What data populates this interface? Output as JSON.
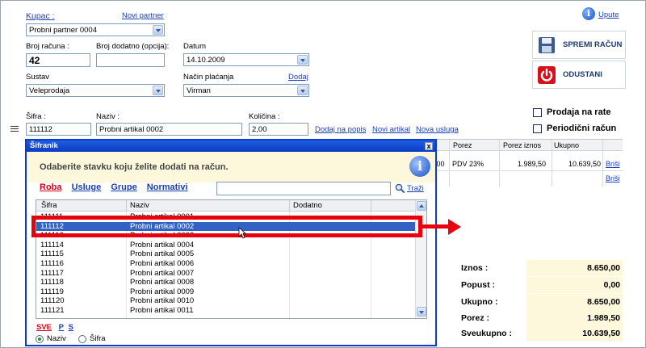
{
  "header": {
    "kupac_label": "Kupac :",
    "novi_partner": "Novi partner",
    "kupac_value": "Probni partner 0004",
    "upute": "Upute"
  },
  "form": {
    "broj_racuna_label": "Broj računa :",
    "broj_racuna_value": "42",
    "broj_dodatno_label": "Broj dodatno (opcija):",
    "broj_dodatno_value": "",
    "datum_label": "Datum",
    "datum_value": "14.10.2009",
    "sustav_label": "Sustav",
    "sustav_value": "Veleprodaja",
    "nacin_placanja_label": "Način plaćanja",
    "dodaj": "Dodaj",
    "nacin_placanja_value": "Virman"
  },
  "item_entry": {
    "sifra_label": "Šifra :",
    "sifra_value": "111112",
    "naziv_label": "Naziv :",
    "naziv_value": "Probni artikal 0002",
    "kolicina_label": "Količina :",
    "kolicina_value": "2,00",
    "dodaj_na_popis": "Dodaj na popis",
    "novi_artikal": "Novi artikal",
    "nova_usluga": "Nova usluga"
  },
  "side": {
    "spremi_label": "SPREMI RAČUN",
    "odustani_label": "ODUSTANI",
    "prodaja_na_rate": "Prodaja na rate",
    "periodicni_racun": "Periodični račun"
  },
  "bg_table": {
    "headers": [
      "Porez",
      "Porez iznos",
      "Ukupno"
    ],
    "row": {
      "cut": ",00",
      "porez": "PDV 23%",
      "porez_iznos": "1.989,50",
      "ukupno": "10.639,50",
      "brisi": "Briši"
    },
    "row2_brisi": "Briši"
  },
  "totals": [
    {
      "label": "Iznos :",
      "value": "8.650,00"
    },
    {
      "label": "Popust :",
      "value": "0,00"
    },
    {
      "label": "Ukupno :",
      "value": "8.650,00"
    },
    {
      "label": "Porez :",
      "value": "1.989,50"
    },
    {
      "label": "Sveukupno :",
      "value": "10.639,50"
    }
  ],
  "dialog": {
    "title": "Šifranik",
    "close": "x",
    "prompt": "Odaberite stavku koju želite dodati na račun.",
    "tabs": [
      "Roba",
      "Usluge",
      "Grupe",
      "Normativi"
    ],
    "search_value": "",
    "trazi": "Traži",
    "columns": [
      "Šifra",
      "Naziv",
      "Dodatno"
    ],
    "rows": [
      {
        "sifra": "111111",
        "naziv": "Probni artikal 0001"
      },
      {
        "sifra": "111112",
        "naziv": "Probni artikal 0002"
      },
      {
        "sifra": "111113",
        "naziv": "Probni artikal 0003"
      },
      {
        "sifra": "111114",
        "naziv": "Probni artikal 0004"
      },
      {
        "sifra": "111115",
        "naziv": "Probni artikal 0005"
      },
      {
        "sifra": "111116",
        "naziv": "Probni artikal 0006"
      },
      {
        "sifra": "111117",
        "naziv": "Probni artikal 0007"
      },
      {
        "sifra": "111118",
        "naziv": "Probni artikal 0008"
      },
      {
        "sifra": "111119",
        "naziv": "Probni artikal 0009"
      },
      {
        "sifra": "111120",
        "naziv": "Probni artikal 0010"
      },
      {
        "sifra": "111121",
        "naziv": "Probni artikal 0011"
      }
    ],
    "selected_index": 1,
    "filter_sve": "SVE",
    "filter_p": "P",
    "filter_s": "S",
    "sort_naziv": "Naziv",
    "sort_sifra": "Šifra",
    "sort_selected": "Naziv"
  },
  "colors": {
    "accent_red": "#e8000e",
    "selection": "#3162c4",
    "dialog_border": "#0a3bd0",
    "banner": "#fdf8dc"
  }
}
